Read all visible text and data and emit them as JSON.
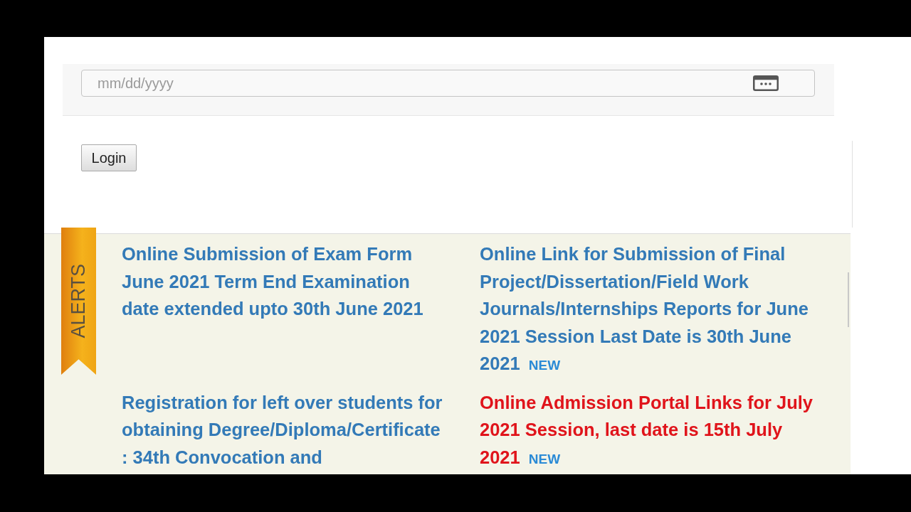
{
  "date_field": {
    "placeholder": "mm/dd/yyyy"
  },
  "login_button": {
    "label": "Login"
  },
  "alerts": {
    "ribbon_label": "ALERTS",
    "items": [
      {
        "text": "Online Submission of Exam Form June 2021 Term End Examination date extended upto 30th June 2021",
        "color": "#337ab7"
      },
      {
        "text": "Online Link for Submission of Final Project/Dissertation/Field Work Journals/Internships Reports for June 2021 Session Last Date is 30th June 2021",
        "color": "#337ab7",
        "badge": "NEW"
      },
      {
        "text": "Registration for left over students for obtaining Degree/Diploma/Certificate : 34th Convocation and",
        "color": "#337ab7"
      },
      {
        "text": "Online Admission Portal Links for July 2021 Session, last date is 15th July 2021",
        "color": "#e0141b",
        "badge": "NEW"
      }
    ]
  }
}
